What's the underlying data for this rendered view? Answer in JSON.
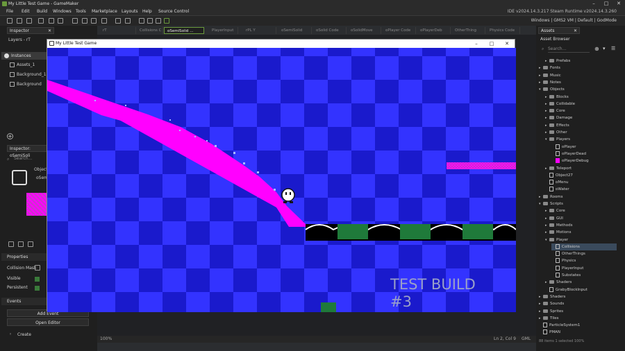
{
  "window": {
    "title": "My Little Test Game - GameMaker",
    "ide_version": "IDE v2024.14.3.217 Steam  Runtime v2024.14.3.260"
  },
  "menu": [
    "File",
    "Edit",
    "Build",
    "Windows",
    "Tools",
    "Marketplace",
    "Layouts",
    "Help",
    "Source Control"
  ],
  "targets": "Windows | GMS2 VM | Default | GodMode",
  "left_panel": {
    "tab": "Inspector",
    "layers_label": "Layers - rT",
    "instances_label": "Instances",
    "layers": [
      "Assets_1",
      "Background_1",
      "Background"
    ],
    "inspector_tab": "Inspector: oSemiSoli",
    "search_placeholder": "Search...",
    "object_label": "Object",
    "object_name": "oSemi",
    "properties_label": "Properties",
    "collision_mask_label": "Collision Mask",
    "visible_label": "Visible",
    "persistent_label": "Persistent",
    "events_label": "Events",
    "add_event_label": "Add Event",
    "open_editor_label": "Open Editor",
    "create_event_label": "Create"
  },
  "editor_tabs": [
    "rT",
    "Collisions C",
    "oSemiSolid ...",
    "PlayerInput",
    "rPL Y",
    "oSemiSolid",
    "oSolid Code",
    "oSolidMove",
    "oPlayer Code",
    "oPlayerDeb",
    "OtherThing",
    "Physics Code"
  ],
  "active_tab_index": 2,
  "status": {
    "zoom": "100%",
    "cursor": "Ln 2, Col 9",
    "lang": "GML"
  },
  "game_window": {
    "title": "My Little Test Game",
    "watermark_line1": "TEST BUILD",
    "watermark_line2": "#3"
  },
  "right_panel": {
    "tab": "Assets",
    "browser_label": "Asset Browser",
    "search_placeholder": "Search...",
    "items": [
      {
        "label": "Prefabs",
        "depth": 1,
        "kind": "folder"
      },
      {
        "label": "Fonts",
        "depth": 0,
        "kind": "folder"
      },
      {
        "label": "Music",
        "depth": 0,
        "kind": "folder"
      },
      {
        "label": "Notes",
        "depth": 0,
        "kind": "folder"
      },
      {
        "label": "Objects",
        "depth": 0,
        "kind": "folder-open"
      },
      {
        "label": "Blocks",
        "depth": 1,
        "kind": "folder"
      },
      {
        "label": "Collidable",
        "depth": 1,
        "kind": "folder"
      },
      {
        "label": "Core",
        "depth": 1,
        "kind": "folder"
      },
      {
        "label": "Damage",
        "depth": 1,
        "kind": "folder"
      },
      {
        "label": "Effects",
        "depth": 1,
        "kind": "folder"
      },
      {
        "label": "Other",
        "depth": 1,
        "kind": "folder"
      },
      {
        "label": "Players",
        "depth": 1,
        "kind": "folder-open"
      },
      {
        "label": "oPlayer",
        "depth": 2,
        "kind": "object"
      },
      {
        "label": "oPlayerDead",
        "depth": 2,
        "kind": "object"
      },
      {
        "label": "oPlayerDebug",
        "depth": 2,
        "kind": "object-pink"
      },
      {
        "label": "Teleport",
        "depth": 1,
        "kind": "folder"
      },
      {
        "label": "Object27",
        "depth": 1,
        "kind": "object"
      },
      {
        "label": "oMenu",
        "depth": 1,
        "kind": "object"
      },
      {
        "label": "oWater",
        "depth": 1,
        "kind": "object"
      },
      {
        "label": "Rooms",
        "depth": 0,
        "kind": "folder"
      },
      {
        "label": "Scripts",
        "depth": 0,
        "kind": "folder-open"
      },
      {
        "label": "Core",
        "depth": 1,
        "kind": "folder"
      },
      {
        "label": "GUI",
        "depth": 1,
        "kind": "folder"
      },
      {
        "label": "Methods",
        "depth": 1,
        "kind": "folder"
      },
      {
        "label": "Motions",
        "depth": 1,
        "kind": "folder"
      },
      {
        "label": "Player",
        "depth": 1,
        "kind": "folder-open"
      },
      {
        "label": "Collisions",
        "depth": 2,
        "kind": "script",
        "selected": true
      },
      {
        "label": "OtherThings",
        "depth": 2,
        "kind": "script"
      },
      {
        "label": "Physics",
        "depth": 2,
        "kind": "script"
      },
      {
        "label": "PlayerInput",
        "depth": 2,
        "kind": "script"
      },
      {
        "label": "Substates",
        "depth": 2,
        "kind": "script"
      },
      {
        "label": "Shaders",
        "depth": 1,
        "kind": "folder"
      },
      {
        "label": "GrabyBlockInput",
        "depth": 1,
        "kind": "script"
      },
      {
        "label": "Shaders",
        "depth": 0,
        "kind": "folder"
      },
      {
        "label": "Sounds",
        "depth": 0,
        "kind": "folder"
      },
      {
        "label": "Sprites",
        "depth": 0,
        "kind": "folder"
      },
      {
        "label": "Tiles",
        "depth": 0,
        "kind": "folder"
      },
      {
        "label": "ParticleSystem1",
        "depth": 0,
        "kind": "script"
      },
      {
        "label": "PMAN",
        "depth": 0,
        "kind": "script"
      }
    ],
    "footer": "88 items    1 selected  100%"
  },
  "colors": {
    "checker_a": "#3333ff",
    "checker_b": "#1a1acc",
    "slope": "#ff00ff",
    "ground": "#000000",
    "grass": "#1f7a3a",
    "accent": "#6a9a3c"
  }
}
